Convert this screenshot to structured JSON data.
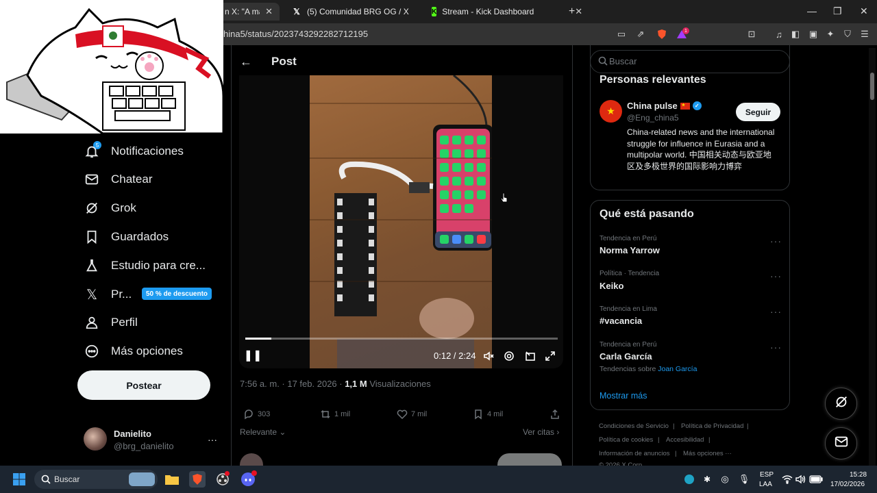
{
  "browser": {
    "tabs": [
      {
        "title": "n X: \"A man u",
        "active": true
      },
      {
        "title": "(5) Comunidad BRG OG / X",
        "active": false
      },
      {
        "title": "Stream - Kick Dashboard",
        "active": false
      }
    ],
    "new_tab_label": "+",
    "url": "hina5/status/2023743292282712195",
    "window_controls": {
      "minimize": "—",
      "maximize": "❐",
      "close": "✕"
    },
    "brave_badge": "1"
  },
  "sidebar": {
    "notif_badge": "5",
    "items": [
      {
        "label": "Notificaciones",
        "icon": "bell-icon"
      },
      {
        "label": "Chatear",
        "icon": "mail-icon"
      },
      {
        "label": "Grok",
        "icon": "grok-icon"
      },
      {
        "label": "Guardados",
        "icon": "bookmark-icon"
      },
      {
        "label": "Estudio para cre...",
        "icon": "flask-icon"
      },
      {
        "label": "Pr...",
        "icon": "x-logo-icon"
      },
      {
        "label": "Perfil",
        "icon": "person-icon"
      },
      {
        "label": "Más opciones",
        "icon": "more-circle-icon"
      }
    ],
    "promo_badge": "50 % de descuento",
    "post_button": "Postear",
    "user": {
      "name": "Danielito",
      "handle": "@brg_danielito",
      "more": "···"
    }
  },
  "post": {
    "header_title": "Post",
    "back": "←",
    "video": {
      "time": "0:12 / 2:24",
      "progress": 0.083
    },
    "timestamp": "7:56 a. m. · 17 feb. 2026 · ",
    "views_count": "1,1 M",
    "views_label": " Visualizaciones",
    "actions": {
      "replies": "303",
      "reposts": "1 mil",
      "likes": "7 mil",
      "bookmarks": "4 mil"
    },
    "sort_label": "Relevante",
    "quotes_label": "Ver citas"
  },
  "right": {
    "search_placeholder": "Buscar",
    "relevant_title": "Personas relevantes",
    "person": {
      "name": "China pulse",
      "handle": "@Eng_china5",
      "bio": "China-related news and the international struggle for influence in Eurasia and a multipolar world. 中国相关动态与欧亚地区及多极世界的国际影响力博弈",
      "follow": "Seguir"
    },
    "trends_title": "Qué está pasando",
    "trends": [
      {
        "category": "Tendencia en Perú",
        "name": "Norma Yarrow"
      },
      {
        "category": "Política · Tendencia",
        "name": "Keiko"
      },
      {
        "category": "Tendencia en Lima",
        "name": "#vacancia"
      },
      {
        "category": "Tendencia en Perú",
        "name": "Carla García",
        "sub": "Tendencias sobre ",
        "sub_link": "Joan García"
      }
    ],
    "show_more": "Mostrar más",
    "footer": [
      "Condiciones de Servicio",
      "|",
      "Política de Privacidad",
      "|",
      "Política de cookies",
      "|",
      "Accesibilidad",
      "|",
      "Información de anuncios",
      "|",
      "Más opciones ···",
      "© 2026 X Corp."
    ]
  },
  "taskbar": {
    "search_label": "Buscar",
    "lang": "ESP",
    "region": "LAA",
    "time": "15:28",
    "date": "17/02/2026"
  },
  "colors": {
    "accent": "#1d9bf0",
    "bg": "#000000",
    "border": "#2f3336",
    "muted": "#71767b"
  }
}
